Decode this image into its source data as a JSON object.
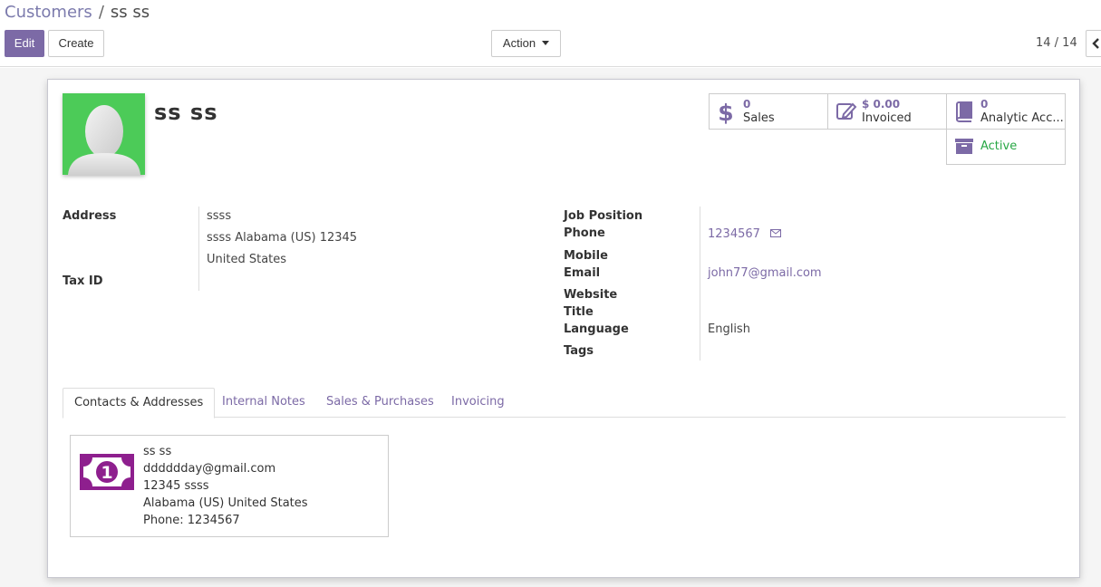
{
  "breadcrumb": {
    "parent": "Customers",
    "separator": "/",
    "current": "ss ss"
  },
  "toolbar": {
    "edit_label": "Edit",
    "create_label": "Create",
    "action_label": "Action"
  },
  "pager": {
    "text": "14 / 14"
  },
  "partner": {
    "name": "ss ss"
  },
  "stats": {
    "sales": {
      "value": "0",
      "label": "Sales"
    },
    "invoiced": {
      "value": "$ 0.00",
      "label": "Invoiced"
    },
    "analytic": {
      "value": "0",
      "label": "Analytic Acc..."
    },
    "active": {
      "label": "Active"
    }
  },
  "left_fields": {
    "address_label": "Address",
    "address_line1": "ssss",
    "address_line2": "ssss  Alabama (US)  12345",
    "address_line3": "United States",
    "tax_id_label": "Tax ID"
  },
  "right_fields": {
    "job_position_label": "Job Position",
    "phone_label": "Phone",
    "phone_value": "1234567",
    "mobile_label": "Mobile",
    "email_label": "Email",
    "email_value": "john77@gmail.com",
    "website_label": "Website",
    "title_label": "Title",
    "language_label": "Language",
    "language_value": "English",
    "tags_label": "Tags"
  },
  "tabs": [
    {
      "label": "Contacts & Addresses",
      "active": true
    },
    {
      "label": "Internal Notes",
      "active": false
    },
    {
      "label": "Sales & Purchases",
      "active": false
    },
    {
      "label": "Invoicing",
      "active": false
    }
  ],
  "contact_card": {
    "name": "ss ss",
    "email": "dddddday@gmail.com",
    "street": "12345 ssss",
    "region": "Alabama (US) United States",
    "phone": "Phone: 1234567",
    "icon_digit": "1"
  },
  "colors": {
    "brand": "#7c6aa6",
    "avatar_bg": "#4ccb58",
    "active_green": "#28a745",
    "card_icon": "#8e1f8e"
  }
}
